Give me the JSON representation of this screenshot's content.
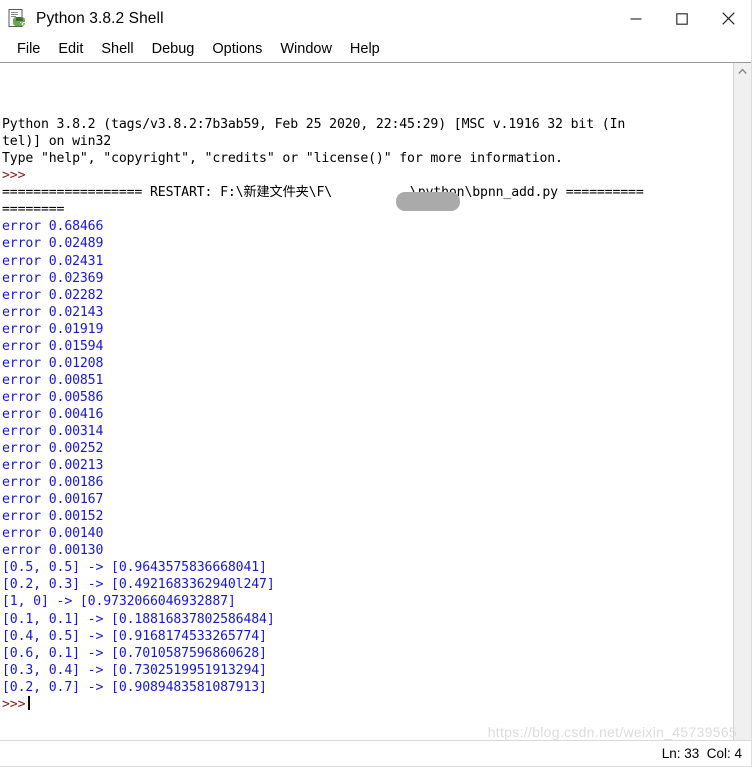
{
  "window": {
    "title": "Python 3.8.2 Shell",
    "icon": "python-idle-icon",
    "controls": {
      "minimize": "minimize-button",
      "maximize": "maximize-button",
      "close": "close-button"
    }
  },
  "menubar": {
    "items": [
      {
        "label": "File"
      },
      {
        "label": "Edit"
      },
      {
        "label": "Shell"
      },
      {
        "label": "Debug"
      },
      {
        "label": "Options"
      },
      {
        "label": "Window"
      },
      {
        "label": "Help"
      }
    ]
  },
  "console": {
    "lines": [
      {
        "color": "black",
        "text": "Python 3.8.2 (tags/v3.8.2:7b3ab59, Feb 25 2020, 22:45:29) [MSC v.1916 32 bit (In"
      },
      {
        "color": "black",
        "text": "tel)] on win32"
      },
      {
        "color": "black",
        "text": "Type \"help\", \"copyright\", \"credits\" or \"license()\" for more information."
      },
      {
        "color": "red",
        "text": ">>>"
      },
      {
        "color": "black",
        "text": "================== RESTART: F:\\新建文件夹\\F\\          \\python\\bpnn_add.py =========="
      },
      {
        "color": "black",
        "text": "========"
      },
      {
        "color": "blue",
        "text": "error 0.68466"
      },
      {
        "color": "blue",
        "text": "error 0.02489"
      },
      {
        "color": "blue",
        "text": "error 0.02431"
      },
      {
        "color": "blue",
        "text": "error 0.02369"
      },
      {
        "color": "blue",
        "text": "error 0.02282"
      },
      {
        "color": "blue",
        "text": "error 0.02143"
      },
      {
        "color": "blue",
        "text": "error 0.01919"
      },
      {
        "color": "blue",
        "text": "error 0.01594"
      },
      {
        "color": "blue",
        "text": "error 0.01208"
      },
      {
        "color": "blue",
        "text": "error 0.00851"
      },
      {
        "color": "blue",
        "text": "error 0.00586"
      },
      {
        "color": "blue",
        "text": "error 0.00416"
      },
      {
        "color": "blue",
        "text": "error 0.00314"
      },
      {
        "color": "blue",
        "text": "error 0.00252"
      },
      {
        "color": "blue",
        "text": "error 0.00213"
      },
      {
        "color": "blue",
        "text": "error 0.00186"
      },
      {
        "color": "blue",
        "text": "error 0.00167"
      },
      {
        "color": "blue",
        "text": "error 0.00152"
      },
      {
        "color": "blue",
        "text": "error 0.00140"
      },
      {
        "color": "blue",
        "text": "error 0.00130"
      },
      {
        "color": "blue",
        "text": "[0.5, 0.5] -> [0.9643575836668041]"
      },
      {
        "color": "blue",
        "text": "[0.2, 0.3] -> [0.4921683362940l247]"
      },
      {
        "color": "blue",
        "text": "[1, 0] -> [0.9732066046932887]"
      },
      {
        "color": "blue",
        "text": "[0.1, 0.1] -> [0.18816837802586484]"
      },
      {
        "color": "blue",
        "text": "[0.4, 0.5] -> [0.9168174533265774]"
      },
      {
        "color": "blue",
        "text": "[0.6, 0.1] -> [0.7010587596860628]"
      },
      {
        "color": "blue",
        "text": "[0.3, 0.4] -> [0.7302519951913294]"
      },
      {
        "color": "blue",
        "text": "[0.2, 0.7] -> [0.9089483581087913]"
      }
    ],
    "prompt": ">>>"
  },
  "training_errors": [
    0.68466,
    0.02489,
    0.02431,
    0.02369,
    0.02282,
    0.02143,
    0.01919,
    0.01594,
    0.01208,
    0.00851,
    0.00586,
    0.00416,
    0.00314,
    0.00252,
    0.00213,
    0.00186,
    0.00167,
    0.00152,
    0.0014,
    0.0013
  ],
  "predictions": [
    {
      "inputs": "[0.5, 0.5]",
      "output": "[0.9643575836668041]"
    },
    {
      "inputs": "[0.2, 0.3]",
      "output": "[0.4921683362940l247]"
    },
    {
      "inputs": "[1, 0]",
      "output": "[0.9732066046932887]"
    },
    {
      "inputs": "[0.1, 0.1]",
      "output": "[0.18816837802586484]"
    },
    {
      "inputs": "[0.4, 0.5]",
      "output": "[0.9168174533265774]"
    },
    {
      "inputs": "[0.6, 0.1]",
      "output": "[0.7010587596860628]"
    },
    {
      "inputs": "[0.3, 0.4]",
      "output": "[0.7302519951913294]"
    },
    {
      "inputs": "[0.2, 0.7]",
      "output": "[0.9089483581087913]"
    }
  ],
  "statusbar": {
    "position": "Ln: 33  Col: 4"
  },
  "watermark": {
    "text": "https://blog.csdn.net/weixin_45739565"
  },
  "colors": {
    "output_blue": "#1818d0",
    "prompt_red": "#8b1a1a",
    "text_black": "#000000",
    "redaction_gray": "#aaaaaa"
  }
}
